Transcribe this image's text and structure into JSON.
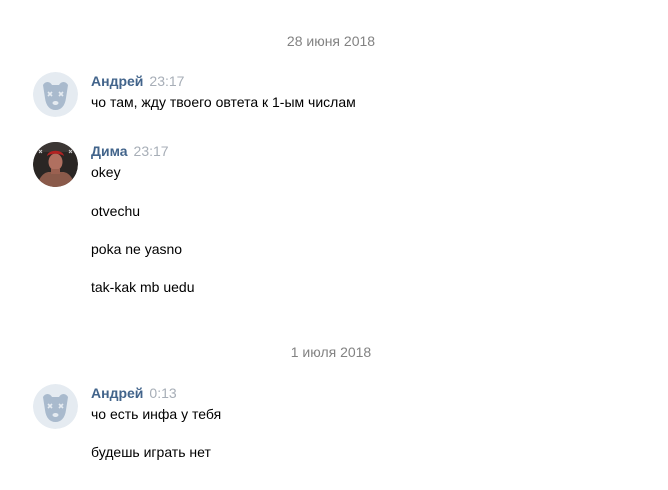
{
  "dates": [
    "28 июня 2018",
    "1 июля 2018"
  ],
  "groups": [
    {
      "author": "Андрей",
      "time": "23:17",
      "avatar_icon": "deactivated-dog-avatar-icon",
      "messages": [
        "чо там, жду твоего овтета к 1-ым числам"
      ]
    },
    {
      "author": "Дима",
      "time": "23:17",
      "avatar_icon": "user-photo-avatar",
      "messages": [
        "okey",
        "otvechu",
        "poka ne yasno",
        "tak-kak mb uedu"
      ]
    },
    {
      "author": "Андрей",
      "time": "0:13",
      "avatar_icon": "deactivated-dog-avatar-icon",
      "messages": [
        "чо есть инфа у тебя",
        "будешь играть нет"
      ]
    }
  ],
  "colors": {
    "author": "#42648b",
    "time": "#a7aeb7",
    "date": "#828282",
    "avatar_bg": "#e5ebf1",
    "avatar_fg": "#a9bacd"
  }
}
